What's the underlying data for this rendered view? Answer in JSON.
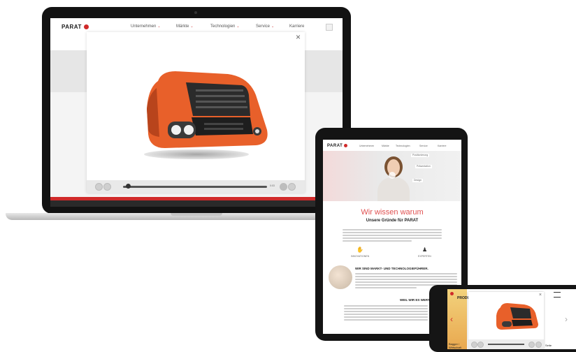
{
  "laptop": {
    "brand": "PARAT",
    "nav": [
      {
        "label": "Unternehmen",
        "arrow": "⌄"
      },
      {
        "label": "Märkte",
        "arrow": "⌄"
      },
      {
        "label": "Technologien",
        "arrow": "⌄"
      },
      {
        "label": "Service",
        "arrow": "⌄"
      },
      {
        "label": "Karriere",
        "arrow": ""
      }
    ],
    "modal_close": "×",
    "player": {
      "time": "0:03",
      "progress": 0.04
    }
  },
  "tablet": {
    "brand": "PARAT",
    "nav": [
      "Unternehmen",
      "Märkte",
      "Technologien",
      "Service",
      "Karriere"
    ],
    "hero_tags": [
      "Positionierung",
      "Präsentation",
      "Design"
    ],
    "headline": "Wir wissen warum",
    "subheadline": "Unsere Gründe für PARAT",
    "icons": [
      {
        "icon": "hand-icon",
        "glyph": "✋",
        "label": "INNOVATIONEN"
      },
      {
        "icon": "person-icon",
        "glyph": "♟",
        "label": "EXPERTEN"
      }
    ],
    "section1_title": "WIR SIND MARKT- UND TECHNOLOGIEFÜHRER.",
    "section2_title": "WEIL WIR ES WERT SIND."
  },
  "phone": {
    "brand_partial": "PRODUKTE",
    "bottom_left": "Bagger / Wirtschaft",
    "bottom_right": "Seite",
    "prev": "‹",
    "next": "›"
  },
  "colors": {
    "accent_red": "#d02a2a",
    "product_orange": "#e8602a",
    "headline_red": "#e05050",
    "device_black": "#111111",
    "silver": "#d8d8d8"
  }
}
